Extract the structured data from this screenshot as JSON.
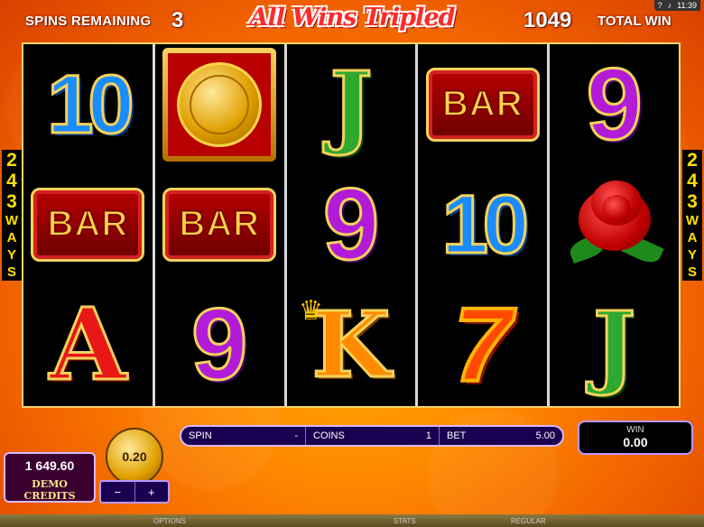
{
  "top": {
    "spins_label": "SPINS REMAINING",
    "spins_value": "3",
    "title": "All Wins Tripled",
    "total_value": "1049",
    "total_label": "TOTAL WIN",
    "system": {
      "help": "?",
      "time": "11:39"
    }
  },
  "ways": {
    "digits": [
      "2",
      "4",
      "3"
    ],
    "word": [
      "W",
      "A",
      "Y",
      "S"
    ]
  },
  "reels": [
    [
      "10",
      "BAR",
      "A"
    ],
    [
      "coin-bonus",
      "BAR",
      "9"
    ],
    [
      "J",
      "9",
      "K"
    ],
    [
      "BAR",
      "10",
      "7"
    ],
    [
      "9",
      "rose-wild",
      "J"
    ]
  ],
  "symbols": {
    "bar_text": "BAR",
    "ten": "10",
    "nine": "9",
    "jack": "J",
    "ace": "A",
    "king": "K",
    "seven": "7"
  },
  "bet_panel": {
    "spin_label": "SPIN",
    "spin_value": "-",
    "coins_label": "COINS",
    "coins_value": "1",
    "bet_label": "BET",
    "bet_value": "5.00"
  },
  "win": {
    "label": "WIN",
    "value": "0.00"
  },
  "credits": {
    "value": "1 649.60",
    "label": "DEMO CREDITS"
  },
  "coin_size": {
    "value": "0.20",
    "decrease": "−",
    "increase": "+"
  },
  "footer": {
    "options": "OPTIONS",
    "stats": "STATS",
    "regular": "REGULAR"
  },
  "colors": {
    "accent": "#ff8a00",
    "panel": "#1a0050",
    "reel_bg": "#000000"
  }
}
